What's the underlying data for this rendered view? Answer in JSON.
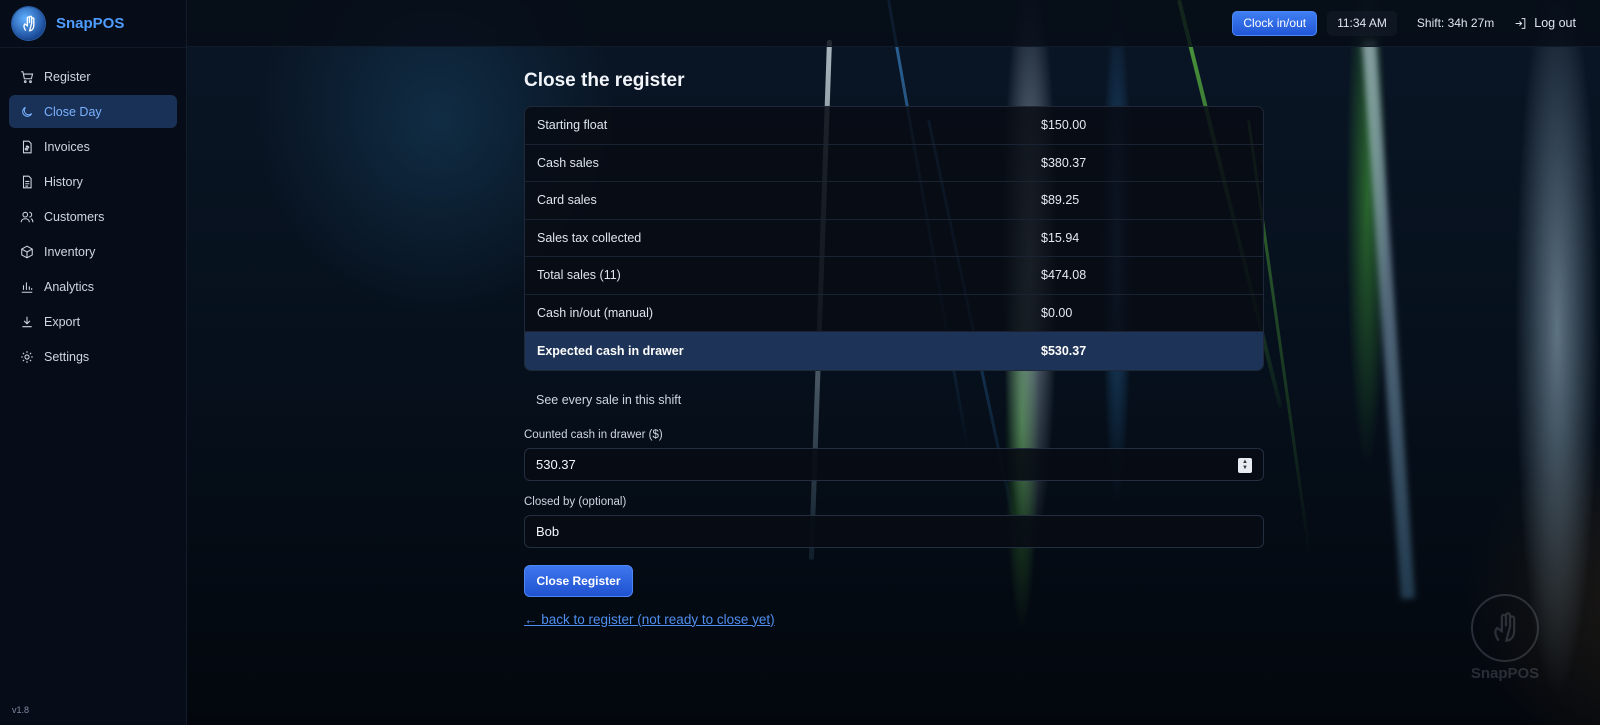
{
  "app": {
    "name": "SnapPOS",
    "version": "v1.8"
  },
  "sidebar": {
    "items": [
      {
        "label": "Register",
        "icon": "cart-icon",
        "active": false
      },
      {
        "label": "Close Day",
        "icon": "moon-icon",
        "active": true
      },
      {
        "label": "Invoices",
        "icon": "invoice-icon",
        "active": false
      },
      {
        "label": "History",
        "icon": "document-icon",
        "active": false
      },
      {
        "label": "Customers",
        "icon": "users-icon",
        "active": false
      },
      {
        "label": "Inventory",
        "icon": "box-icon",
        "active": false
      },
      {
        "label": "Analytics",
        "icon": "bar-chart-icon",
        "active": false
      },
      {
        "label": "Export",
        "icon": "download-icon",
        "active": false
      },
      {
        "label": "Settings",
        "icon": "gear-icon",
        "active": false
      }
    ]
  },
  "topbar": {
    "clock_button": "Clock in/out",
    "time": "11:34 AM",
    "shift": "Shift: 34h 27m",
    "logout": "Log out"
  },
  "main": {
    "title": "Close the register",
    "summary": [
      {
        "label": "Starting float",
        "value": "$150.00"
      },
      {
        "label": "Cash sales",
        "value": "$380.37"
      },
      {
        "label": "Card sales",
        "value": "$89.25"
      },
      {
        "label": "Sales tax collected",
        "value": "$15.94"
      },
      {
        "label": "Total sales (11)",
        "value": "$474.08"
      },
      {
        "label": "Cash in/out (manual)",
        "value": "$0.00"
      },
      {
        "label": "Expected cash in drawer",
        "value": "$530.37",
        "highlight": true
      }
    ],
    "see_sales_link": "See every sale in this shift",
    "counted_cash": {
      "label": "Counted cash in drawer ($)",
      "value": "530.37"
    },
    "closed_by": {
      "label": "Closed by (optional)",
      "value": "Bob"
    },
    "close_button": "Close Register",
    "back_link": "← back to register (not ready to close yet)"
  },
  "colors": {
    "accent": "#2f6bea",
    "active_nav_bg": "#1a3157",
    "highlight_row_bg": "#1d3357"
  }
}
